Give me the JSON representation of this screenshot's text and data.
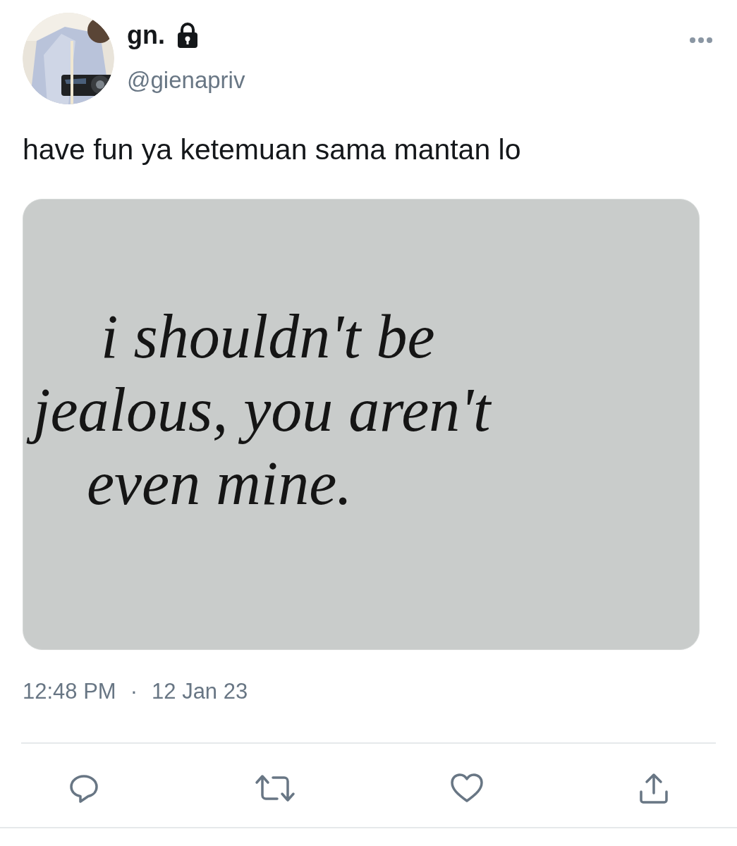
{
  "tweet": {
    "author": {
      "name": "gn.",
      "locked": true,
      "handle": "@gienapriv"
    },
    "text": "have fun ya ketemuan sama mantan lo",
    "media": {
      "lines": [
        "i shouldn't be",
        "jealous, you aren't",
        "even mine."
      ]
    },
    "time": "12:48 PM",
    "separator": "·",
    "date": "12 Jan 23",
    "actions": [
      {
        "kind": "reply"
      },
      {
        "kind": "retweet"
      },
      {
        "kind": "like"
      },
      {
        "kind": "share"
      }
    ]
  }
}
